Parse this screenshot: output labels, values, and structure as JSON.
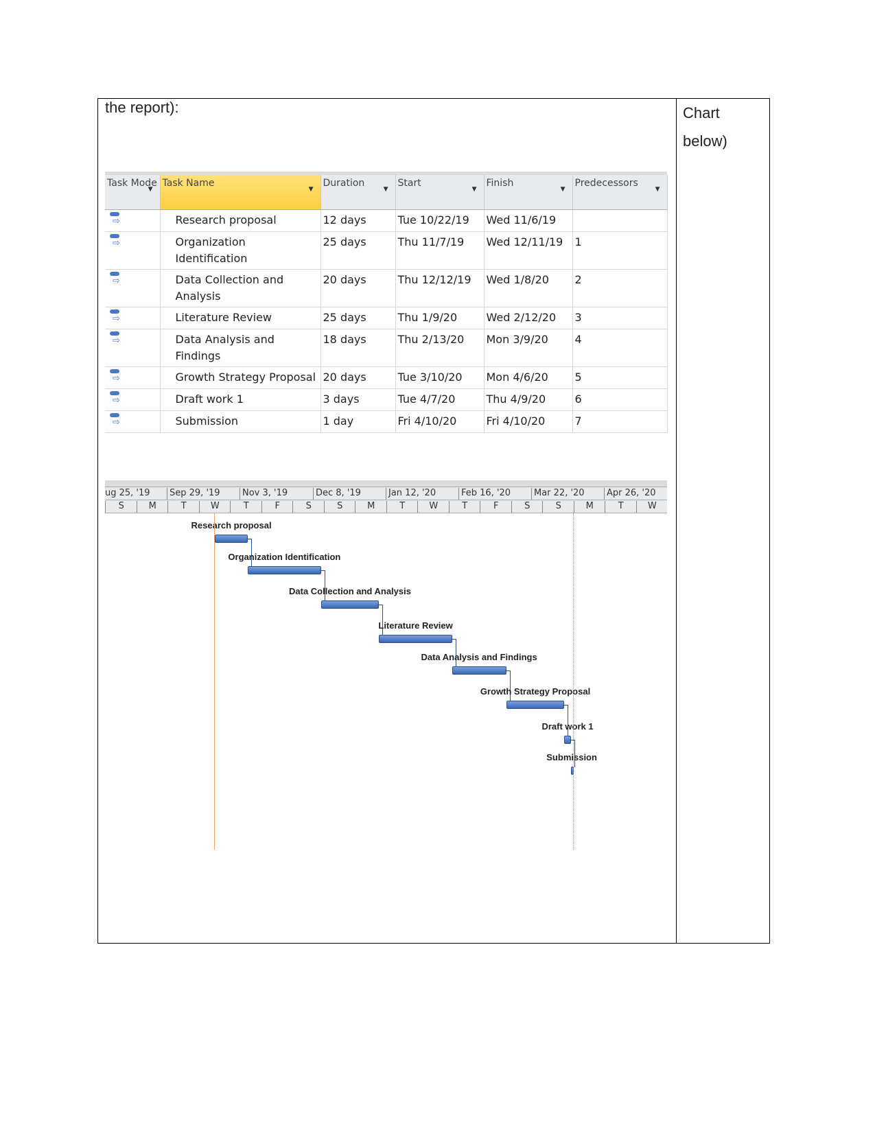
{
  "document": {
    "left_text": "the report):",
    "right_text_1": "Chart",
    "right_text_2": "below)"
  },
  "grid": {
    "headers": [
      "Task Mode",
      "Task Name",
      "Duration",
      "Start",
      "Finish",
      "Predecessors"
    ],
    "rows": [
      {
        "name": "Research proposal",
        "duration": "12 days",
        "start": "Tue 10/22/19",
        "finish": "Wed 11/6/19",
        "pred": ""
      },
      {
        "name": "Organization Identification",
        "duration": "25 days",
        "start": "Thu 11/7/19",
        "finish": "Wed 12/11/19",
        "pred": "1"
      },
      {
        "name": "Data Collection and Analysis",
        "duration": "20 days",
        "start": "Thu 12/12/19",
        "finish": "Wed 1/8/20",
        "pred": "2"
      },
      {
        "name": "Literature Review",
        "duration": "25 days",
        "start": "Thu 1/9/20",
        "finish": "Wed 2/12/20",
        "pred": "3"
      },
      {
        "name": "Data Analysis and Findings",
        "duration": "18 days",
        "start": "Thu 2/13/20",
        "finish": "Mon 3/9/20",
        "pred": "4"
      },
      {
        "name": "Growth Strategy Proposal",
        "duration": "20 days",
        "start": "Tue 3/10/20",
        "finish": "Mon 4/6/20",
        "pred": "5"
      },
      {
        "name": "Draft work 1",
        "duration": "3 days",
        "start": "Tue 4/7/20",
        "finish": "Thu 4/9/20",
        "pred": "6"
      },
      {
        "name": "Submission",
        "duration": "1 day",
        "start": "Fri 4/10/20",
        "finish": "Fri 4/10/20",
        "pred": "7"
      }
    ]
  },
  "gantt": {
    "top_tier": [
      "ug 25, '19",
      "Sep 29, '19",
      "Nov 3, '19",
      "Dec 8, '19",
      "Jan 12, '20",
      "Feb 16, '20",
      "Mar 22, '20",
      "Apr 26, '20"
    ],
    "bottom_tier": [
      "S",
      "M",
      "T",
      "W",
      "T",
      "F",
      "S",
      "S",
      "M",
      "T",
      "W",
      "T",
      "F",
      "S",
      "S",
      "M",
      "T",
      "W"
    ],
    "tasks": [
      {
        "label": "Research proposal",
        "start": "2019-10-22",
        "end": "2019-11-06"
      },
      {
        "label": "Organization Identification",
        "start": "2019-11-07",
        "end": "2019-12-11"
      },
      {
        "label": "Data Collection and Analysis",
        "start": "2019-12-12",
        "end": "2020-01-08"
      },
      {
        "label": "Literature Review",
        "start": "2020-01-09",
        "end": "2020-02-12"
      },
      {
        "label": "Data Analysis and Findings",
        "start": "2020-02-13",
        "end": "2020-03-09"
      },
      {
        "label": "Growth Strategy Proposal",
        "start": "2020-03-10",
        "end": "2020-04-06"
      },
      {
        "label": "Draft work 1",
        "start": "2020-04-07",
        "end": "2020-04-09"
      },
      {
        "label": "Submission",
        "start": "2020-04-10",
        "end": "2020-04-10"
      }
    ],
    "bar_color": "#3a67b5",
    "today_line_color": "#f0a070"
  }
}
